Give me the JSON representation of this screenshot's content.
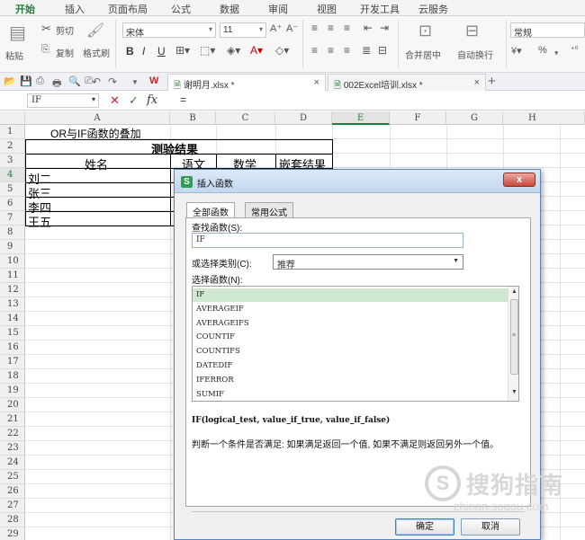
{
  "ribbon_tabs": [
    "开始",
    "插入",
    "页面布局",
    "公式",
    "数据",
    "审阅",
    "视图",
    "开发工具",
    "云服务"
  ],
  "ribbon": {
    "paste": "粘贴",
    "cut": "剪切",
    "copy": "复制",
    "format_painter": "格式刷",
    "font_name": "宋体",
    "font_size": "11",
    "bold": "B",
    "italic": "I",
    "underline": "U",
    "merge_center": "合并居中",
    "wrap_text": "自动换行",
    "number_format": "常规",
    "percent": "%"
  },
  "file_tabs": [
    {
      "name": "谢明月.xlsx *"
    },
    {
      "name": "002Excel培训.xlsx *"
    }
  ],
  "formula_bar": {
    "name_box": "IF",
    "fx": "fx",
    "value": "="
  },
  "grid": {
    "columns": [
      "A",
      "B",
      "C",
      "D",
      "E",
      "F",
      "G",
      "H"
    ],
    "rows": [
      "1",
      "2",
      "3",
      "4",
      "5",
      "6",
      "7",
      "8",
      "9",
      "10",
      "11",
      "12",
      "13",
      "14",
      "15",
      "16",
      "17",
      "18",
      "19",
      "20",
      "21",
      "22",
      "23",
      "24",
      "25",
      "26",
      "27",
      "28",
      "29"
    ],
    "selected_column": "E",
    "selected_row": "4",
    "a1": "OR与IF函数的叠加",
    "title": "测验结果",
    "headers": [
      "姓名",
      "语文",
      "数学",
      "嵌套结果"
    ],
    "names": [
      "刘二",
      "张三",
      "李四",
      "王五"
    ]
  },
  "dialog": {
    "title": "插入函数",
    "close": "x",
    "tab_all": "全部函数",
    "tab_common": "常用公式",
    "search_label": "查找函数(S):",
    "search_value": "IF",
    "category_label": "或选择类别(C):",
    "category_value": "推荐",
    "select_label": "选择函数(N):",
    "functions": [
      "IF",
      "AVERAGEIF",
      "AVERAGEIFS",
      "COUNTIF",
      "COUNTIFS",
      "DATEDIF",
      "IFERROR",
      "SUMIF"
    ],
    "selected_function": "IF",
    "syntax": "IF(logical_test, value_if_true, value_if_false)",
    "description": "判断一个条件是否满足: 如果满足返回一个值, 如果不满足则返回另外一个值。",
    "ok": "确定",
    "cancel": "取消"
  },
  "watermark": {
    "text": "搜狗指南",
    "url": "zhinan.sogou.com",
    "logo_letter": "S"
  },
  "colors": {
    "accent": "#1f7f3c",
    "selection": "#cfe8cf",
    "dialog_title": "#c3d7ef",
    "close_button": "#c9473a"
  }
}
